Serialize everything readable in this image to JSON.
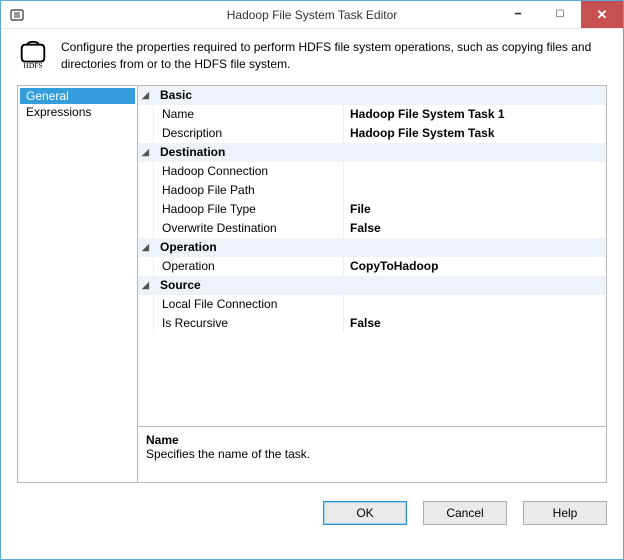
{
  "window": {
    "title": "Hadoop File System Task Editor",
    "icon_name": "hdfs-icon"
  },
  "header": {
    "icon_label": "HDFS",
    "description": "Configure the properties required to perform HDFS file system operations, such as copying files and directories from or to the HDFS file system."
  },
  "nav": {
    "items": [
      {
        "label": "General",
        "selected": true
      },
      {
        "label": "Expressions",
        "selected": false
      }
    ]
  },
  "property_grid": {
    "categories": [
      {
        "name": "Basic",
        "rows": [
          {
            "label": "Name",
            "value": "Hadoop File System Task 1",
            "bold": true
          },
          {
            "label": "Description",
            "value": "Hadoop File System Task",
            "bold": true
          }
        ]
      },
      {
        "name": "Destination",
        "rows": [
          {
            "label": "Hadoop Connection",
            "value": "",
            "bold": false
          },
          {
            "label": "Hadoop File Path",
            "value": "",
            "bold": false
          },
          {
            "label": "Hadoop File Type",
            "value": "File",
            "bold": true
          },
          {
            "label": "Overwrite Destination",
            "value": "False",
            "bold": true
          }
        ]
      },
      {
        "name": "Operation",
        "rows": [
          {
            "label": "Operation",
            "value": "CopyToHadoop",
            "bold": true
          }
        ]
      },
      {
        "name": "Source",
        "rows": [
          {
            "label": "Local File Connection",
            "value": "",
            "bold": false
          },
          {
            "label": "Is Recursive",
            "value": "False",
            "bold": true
          }
        ]
      }
    ]
  },
  "help_panel": {
    "title": "Name",
    "text": "Specifies the name of the task."
  },
  "footer": {
    "ok_label": "OK",
    "cancel_label": "Cancel",
    "help_label": "Help"
  }
}
